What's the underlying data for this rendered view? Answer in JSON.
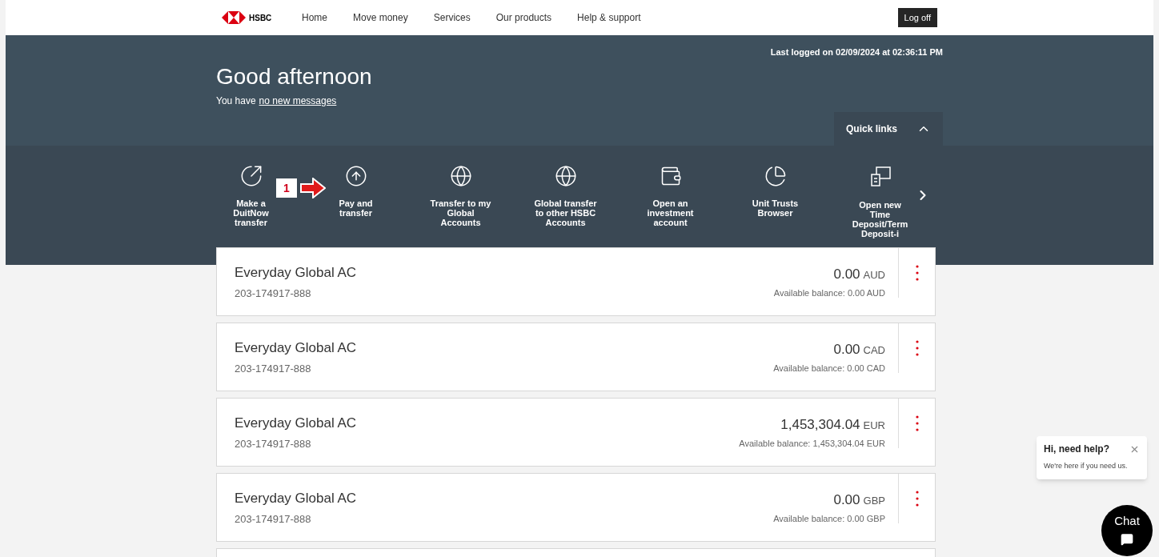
{
  "nav": {
    "logo": "HSBC",
    "items": [
      "Home",
      "Move money",
      "Services",
      "Our products",
      "Help & support"
    ],
    "logoff": "Log off"
  },
  "header": {
    "last_logged": "Last logged on 02/09/2024 at 02:36:11 PM",
    "greeting": "Good afternoon",
    "messages_prefix": "You have",
    "messages_link": "no new messages",
    "quick_links_toggle": "Quick links",
    "expanded": true
  },
  "quick_links": [
    "Make a DuitNow transfer",
    "Pay and transfer",
    "Transfer to my Global Accounts",
    "Global transfer to other HSBC Accounts",
    "Open an investment account",
    "Unit Trusts Browser",
    "Open new Time Deposit/Term Deposit-i"
  ],
  "annotation": {
    "label": "1"
  },
  "accounts": [
    {
      "name": "Everyday Global AC",
      "number": "203-174917-888",
      "amount": "0.00",
      "currency": "AUD",
      "available": "Available balance: 0.00 AUD"
    },
    {
      "name": "Everyday Global AC",
      "number": "203-174917-888",
      "amount": "0.00",
      "currency": "CAD",
      "available": "Available balance: 0.00 CAD"
    },
    {
      "name": "Everyday Global AC",
      "number": "203-174917-888",
      "amount": "1,453,304.04",
      "currency": "EUR",
      "available": "Available balance: 1,453,304.04 EUR"
    },
    {
      "name": "Everyday Global AC",
      "number": "203-174917-888",
      "amount": "0.00",
      "currency": "GBP",
      "available": "Available balance: 0.00 GBP"
    }
  ],
  "chat": {
    "title": "Hi, need help?",
    "text": "We're here if you need us.",
    "button": "Chat"
  }
}
